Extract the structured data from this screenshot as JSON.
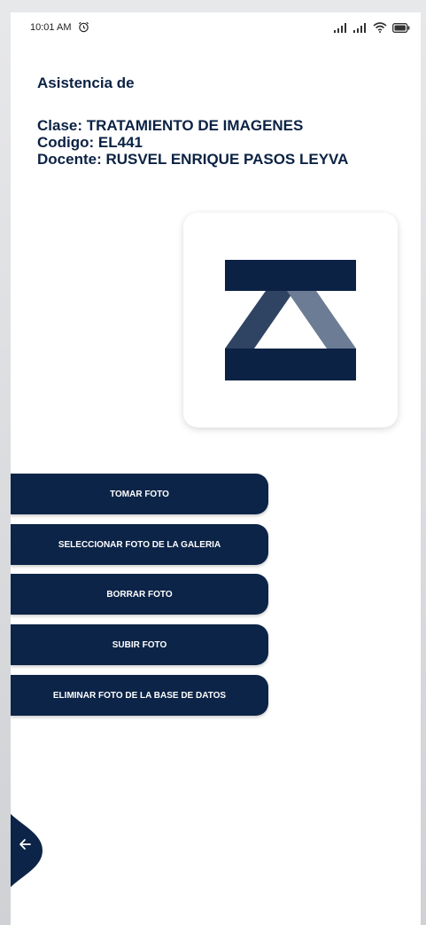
{
  "status_bar": {
    "time": "10:01 AM",
    "icons": [
      "alarm-icon",
      "signal-icon",
      "signal-icon",
      "wifi-icon",
      "battery-icon"
    ]
  },
  "header": {
    "title": "Asistencia de",
    "clase": "Clase: TRATAMIENTO DE IMAGENES",
    "codigo": "Codigo: EL441",
    "docente": "Docente: RUSVEL ENRIQUE PASOS LEYVA"
  },
  "actions": {
    "take_photo": "TOMAR FOTO",
    "select_gallery": "SELECCIONAR FOTO DE LA GALERIA",
    "delete_photo": "BORRAR FOTO",
    "upload_photo": "SUBIR FOTO",
    "delete_from_db": "ELIMINAR FOTO DE LA BASE DE DATOS"
  },
  "navigation": {
    "back_icon": "arrow-left-icon"
  },
  "colors": {
    "primary": "#0c2447",
    "logo_dark": "#0b2244",
    "logo_mid": "#2f4362",
    "logo_light": "#6b7c94",
    "background": "#ffffff"
  }
}
